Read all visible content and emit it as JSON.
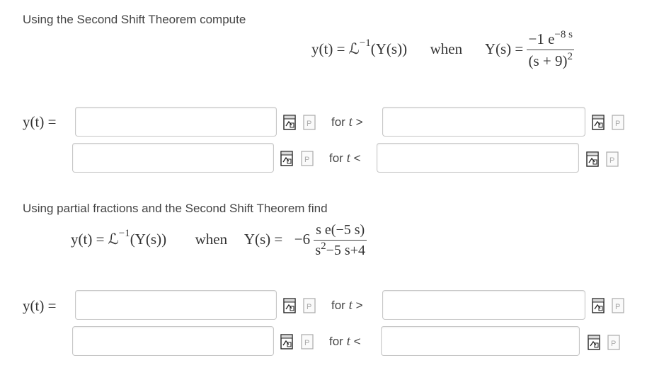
{
  "problem1": {
    "prompt": "Using the Second Shift Theorem compute",
    "equation": {
      "lhs": "y(t) = ℒ",
      "inv": "−1",
      "arg": "(Y(s))",
      "when": "when",
      "ys": "Y(s) =",
      "num_coef": "−1",
      "num_base": "e",
      "num_exp": "−8 s",
      "den": "(s + 9)",
      "den_exp": "2"
    },
    "y_label": "y(t) =",
    "row1": {
      "expr_value": "",
      "cond_prefix": "for ",
      "cond_var": "t",
      "cond_op": " >",
      "bound_value": ""
    },
    "row2": {
      "expr_value": "",
      "cond_prefix": "for ",
      "cond_var": "t",
      "cond_op": " <",
      "bound_value": ""
    }
  },
  "problem2": {
    "prompt": "Using partial fractions and the Second Shift Theorem find",
    "equation": {
      "lhs": "y(t) = ℒ",
      "inv": "−1",
      "arg": "(Y(s))",
      "when": "when",
      "ys": "Y(s) =",
      "coef": "−6",
      "num": "s e(−5 s)",
      "den_base": "s",
      "den_exp": "2",
      "den_rest": "−5 s+4"
    },
    "y_label": "y(t) =",
    "row1": {
      "expr_value": "",
      "cond_prefix": "for ",
      "cond_var": "t",
      "cond_op": " >",
      "bound_value": ""
    },
    "row2": {
      "expr_value": "",
      "cond_prefix": "for ",
      "cond_var": "t",
      "cond_op": " <",
      "bound_value": ""
    }
  },
  "icons": {
    "equation_editor": "equation-editor-icon",
    "preview": "preview-icon"
  }
}
